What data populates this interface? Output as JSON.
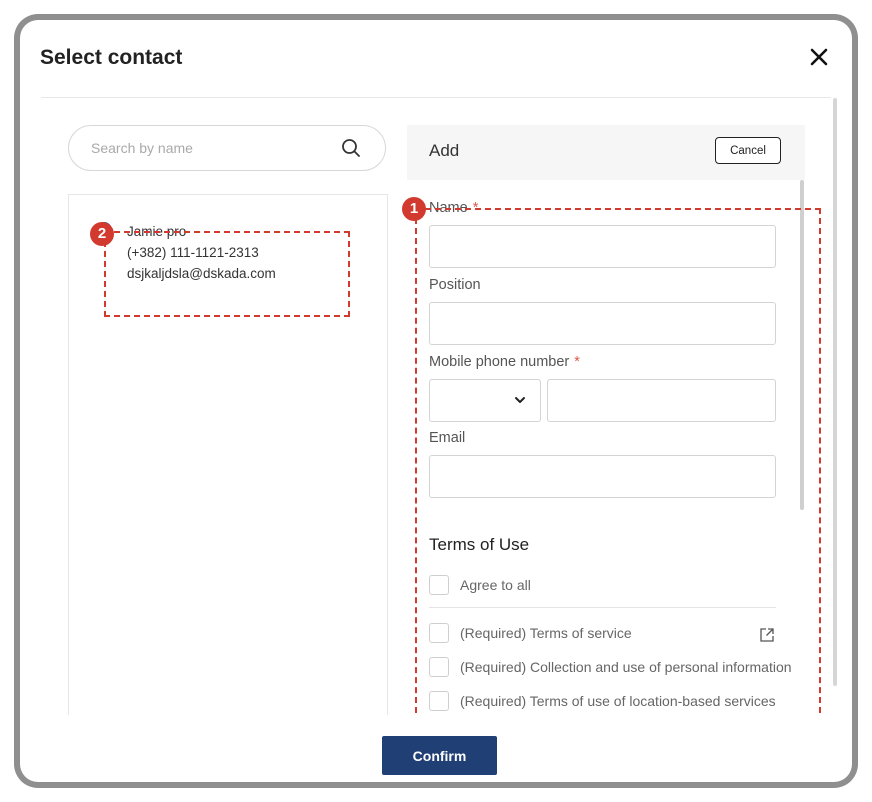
{
  "dialog": {
    "title": "Select contact",
    "confirm_label": "Confirm"
  },
  "search": {
    "placeholder": "Search by name"
  },
  "contacts": [
    {
      "name": "Jamie pro",
      "phone": "(+382) 111-1121-2313",
      "email": "dsjkaljdsla@dskada.com",
      "selected": true
    }
  ],
  "add_panel": {
    "title": "Add",
    "cancel_label": "Cancel",
    "fields": {
      "name_label": "Name",
      "position_label": "Position",
      "mobile_label": "Mobile phone number",
      "email_label": "Email",
      "required_mark": "*"
    },
    "terms": {
      "title": "Terms of Use",
      "agree_all": "Agree to all",
      "items": [
        "(Required) Terms of service",
        "(Required) Collection and use of personal information",
        "(Required) Terms of use of location-based services"
      ]
    }
  },
  "annotations": {
    "badge_1": "1",
    "badge_2": "2"
  },
  "colors": {
    "primary": "#1f3f75",
    "annotation": "#d33a2f",
    "required": "#e0584d"
  }
}
